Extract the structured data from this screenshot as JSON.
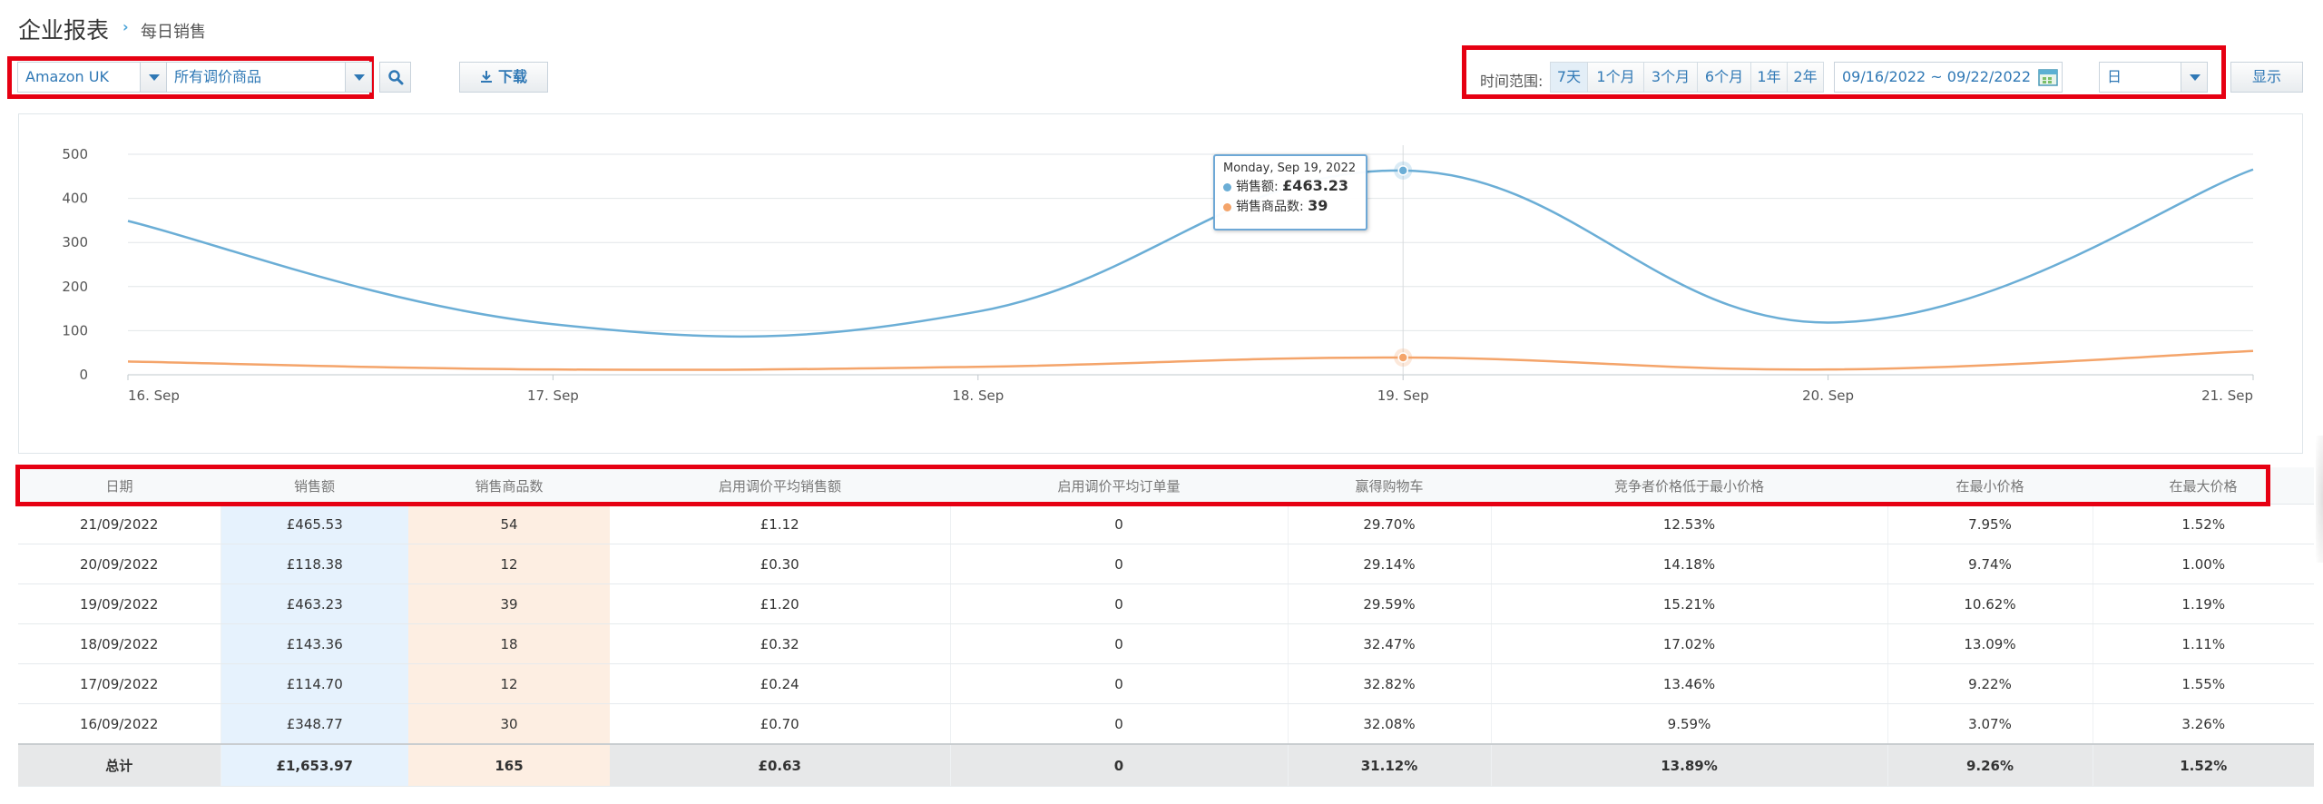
{
  "header": {
    "title": "企业报表",
    "breadcrumb_sep": "›",
    "breadcrumb": "每日销售"
  },
  "filters": {
    "marketplace": "Amazon UK",
    "product_scope": "所有调价商品",
    "search_icon": "search-icon",
    "download_label": "下载",
    "download_icon": "download-icon"
  },
  "range": {
    "label": "时间范围:",
    "options": [
      "7天",
      "1个月",
      "3个月",
      "6个月",
      "1年",
      "2年"
    ],
    "active": "7天",
    "date_range": "09/16/2022 ~ 09/22/2022",
    "calendar_icon": "calendar-icon",
    "granularity": "日",
    "show_label": "显示"
  },
  "chart_data": {
    "type": "line",
    "x": [
      "16. Sep",
      "17. Sep",
      "18. Sep",
      "19. Sep",
      "20. Sep",
      "21. Sep"
    ],
    "yticks": [
      0,
      100,
      200,
      300,
      400,
      500
    ],
    "ylim": [
      0,
      500
    ],
    "series": [
      {
        "name": "销售额",
        "color": "#6baed6",
        "values": [
          348.77,
          114.7,
          143.36,
          463.23,
          118.38,
          465.53
        ]
      },
      {
        "name": "销售商品数",
        "color": "#f4a46a",
        "values": [
          30,
          12,
          18,
          39,
          12,
          54
        ]
      }
    ],
    "tooltip": {
      "date": "Monday, Sep 19, 2022",
      "line1_label": "销售额:",
      "line1_value": "£463.23",
      "line2_label": "销售商品数:",
      "line2_value": "39"
    }
  },
  "table": {
    "headers": [
      "日期",
      "销售额",
      "销售商品数",
      "启用调价平均销售额",
      "启用调价平均订单量",
      "赢得购物车",
      "竞争者价格低于最小价格",
      "在最小价格",
      "在最大价格"
    ],
    "rows": [
      [
        "21/09/2022",
        "£465.53",
        "54",
        "£1.12",
        "0",
        "29.70%",
        "12.53%",
        "7.95%",
        "1.52%"
      ],
      [
        "20/09/2022",
        "£118.38",
        "12",
        "£0.30",
        "0",
        "29.14%",
        "14.18%",
        "9.74%",
        "1.00%"
      ],
      [
        "19/09/2022",
        "£463.23",
        "39",
        "£1.20",
        "0",
        "29.59%",
        "15.21%",
        "10.62%",
        "1.19%"
      ],
      [
        "18/09/2022",
        "£143.36",
        "18",
        "£0.32",
        "0",
        "32.47%",
        "17.02%",
        "13.09%",
        "1.11%"
      ],
      [
        "17/09/2022",
        "£114.70",
        "12",
        "£0.24",
        "0",
        "32.82%",
        "13.46%",
        "9.22%",
        "1.55%"
      ],
      [
        "16/09/2022",
        "£348.77",
        "30",
        "£0.70",
        "0",
        "32.08%",
        "9.59%",
        "3.07%",
        "3.26%"
      ]
    ],
    "total": [
      "总计",
      "£1,653.97",
      "165",
      "£0.63",
      "0",
      "31.12%",
      "13.89%",
      "9.26%",
      "1.52%"
    ]
  }
}
